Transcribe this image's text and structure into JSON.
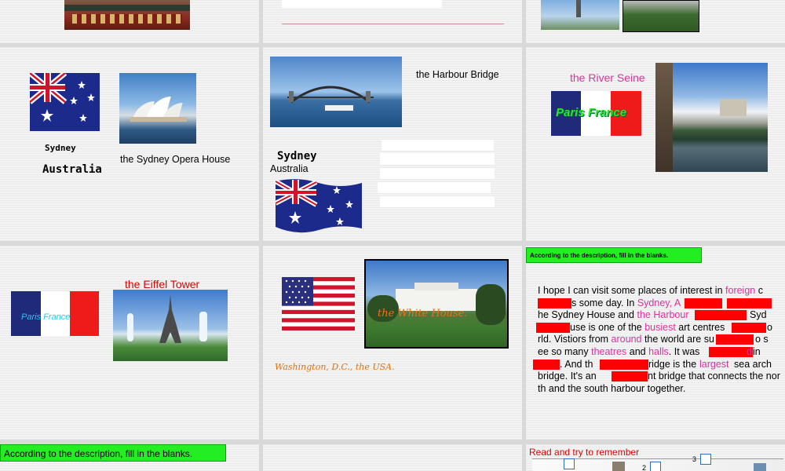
{
  "slides": {
    "s1": {},
    "s2": {},
    "s3": {},
    "s4": {
      "city": "Sydney",
      "country": "Australia",
      "landmark": "the Sydney Opera House"
    },
    "s5": {
      "landmark": "the Harbour Bridge",
      "city": "Sydney",
      "country": "Australia"
    },
    "s6": {
      "landmark": "the River Seine",
      "flag_text": "Paris   France"
    },
    "s7": {
      "landmark": "the Eiffel Tower",
      "flag_text": "Paris France"
    },
    "s8": {
      "photo_caption": "the White House.",
      "place": "Washington, D.C., the USA."
    },
    "s9": {
      "banner": "According to the description, fill in the blanks.",
      "passage": {
        "l1a": "I hope I can visit  some places of interest in ",
        "l1b": "foreign",
        "l1c": " c",
        "l2a": "s some day. In ",
        "l2b": "Sydney",
        "l2c": ", A",
        "l3a": "he Sydney House and ",
        "l3b": "the Harbour",
        "l3c": "Syd",
        "l4a": "use is one of the ",
        "l4b": "busiest",
        "l4c": " art centres",
        "l4d": "o",
        "l5a": "rld. Vistiors from ",
        "l5b": "around",
        "l5c": " the world are su",
        "l5d": "o s",
        "l6a": "ee so many ",
        "l6b": "theatres",
        "l6c": " and ",
        "l6d": "halls",
        "l6e": ". It was ",
        "l6f": "d",
        "l6g": " in",
        "l7a": ". And th",
        "l7b": "ridge is the ",
        "l7c": "largest",
        "l7d": " sea arch",
        "l8a": "bridge. It's an",
        "l8b": "nt bridge that connects the nor",
        "l9": "th and the south harbour together."
      }
    },
    "s10": {
      "banner": "According to the description, fill in the blanks."
    },
    "s11": {},
    "s12": {
      "title": "Read and try to remember",
      "n3": "3",
      "n2": "2"
    }
  },
  "colors": {
    "pink": "#e0309a",
    "red": "#e00000",
    "green_banner": "#22ee22",
    "usa_navy": "#2a2f80"
  }
}
